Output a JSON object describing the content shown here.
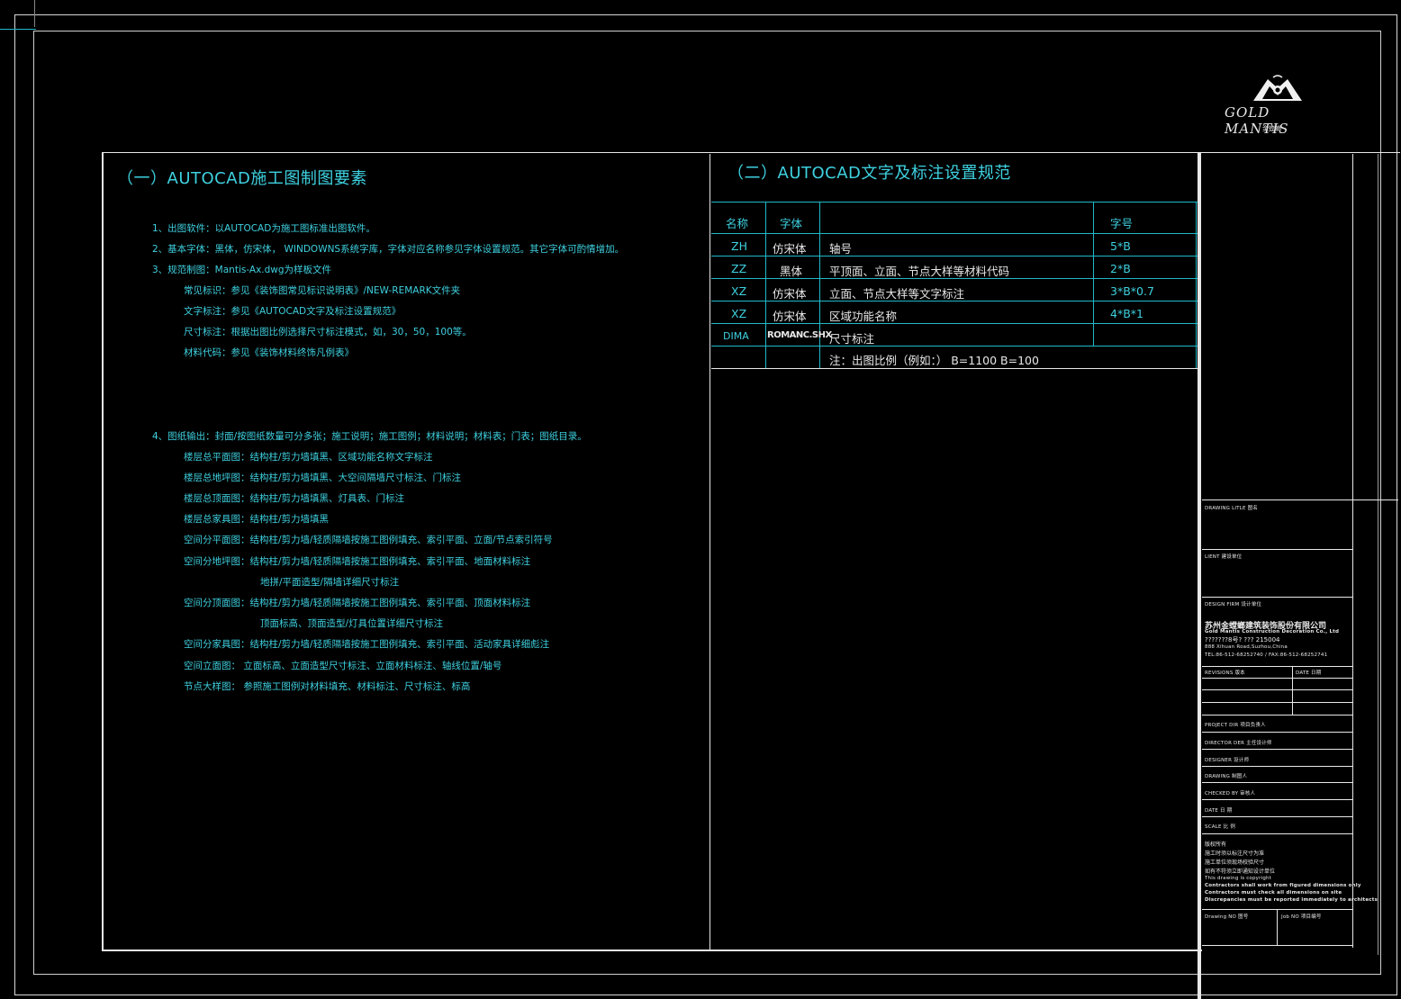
{
  "logo": {
    "brand_text": "GOLD MANTIS",
    "sub_text": "金螳螂",
    "icon": "mantis-logo-icon"
  },
  "section1": {
    "title": "（一）AUTOCAD施工图制图要素",
    "lines": [
      {
        "text": "1、出图软件：以AUTOCAD为施工图标准出图软件。",
        "indent": 0
      },
      {
        "text": "2、基本字体：黑体，仿宋体， WINDOWNS系统字库，字体对应名称参见字体设置规范。其它字体可酌情增加。",
        "indent": 0
      },
      {
        "text": "3、规范制图：Mantis-Ax.dwg为样板文件",
        "indent": 0
      },
      {
        "text": "常见标识：参见《装饰图常见标识说明表》/NEW-REMARK文件夹",
        "indent": 1
      },
      {
        "text": "文字标注：参见《AUTOCAD文字及标注设置规范》",
        "indent": 1
      },
      {
        "text": "尺寸标注：根据出图比例选择尺寸标注模式，如，30，50，100等。",
        "indent": 1
      },
      {
        "text": "材料代码：参见《装饰材料终饰凡例表》",
        "indent": 1
      }
    ],
    "lines2": [
      {
        "text": "4、图纸输出：封面/按图纸数量可分多张；施工说明；施工图例；材料说明；材料表；门表；图纸目录。",
        "indent": 0
      },
      {
        "text": "楼层总平面图：结构柱/剪力墙填黑、区域功能名称文字标注",
        "indent": 1
      },
      {
        "text": "楼层总地坪图：结构柱/剪力墙填黑、大空间隔墙尺寸标注、门标注",
        "indent": 1
      },
      {
        "text": "楼层总顶面图：结构柱/剪力墙填黑、灯具表、门标注",
        "indent": 1
      },
      {
        "text": "楼层总家具图：结构柱/剪力墙填黑",
        "indent": 1
      },
      {
        "text": "空间分平面图：结构柱/剪力墙/轻质隔墙按施工图例填充、索引平面、立面/节点索引符号",
        "indent": 1
      },
      {
        "text": "空间分地坪图：结构柱/剪力墙/轻质隔墙按施工图例填充、索引平面、地面材料标注",
        "indent": 1
      },
      {
        "text": "地拼/平面造型/隔墙详细尺寸标注",
        "indent": 2
      },
      {
        "text": "空间分顶面图：结构柱/剪力墙/轻质隔墙按施工图例填充、索引平面、顶面材料标注",
        "indent": 1
      },
      {
        "text": "顶面标高、顶面造型/灯具位置详细尺寸标注",
        "indent": 2
      },
      {
        "text": "空间分家具图：结构柱/剪力墙/轻质隔墙按施工图例填充、索引平面、活动家具详细彪注",
        "indent": 1
      },
      {
        "text": "空间立面图：   立面标高、立面造型尺寸标注、立面材料标注、轴线位置/轴号",
        "indent": 1
      },
      {
        "text": "节点大样图：   参照施工图例对材料填充、材料标注、尺寸标注、标高",
        "indent": 1
      }
    ]
  },
  "section2": {
    "title": "（二）AUTOCAD文字及标注设置规范",
    "headers": {
      "name": "名称",
      "font": "字体",
      "desc": "",
      "size": "字号"
    },
    "rows": [
      {
        "name": "ZH",
        "font": "仿宋体",
        "desc": "轴号",
        "size": "5*B"
      },
      {
        "name": "ZZ",
        "font": "黑体",
        "desc": "平顶面、立面、节点大样等材料代码",
        "size": "2*B"
      },
      {
        "name": "XZ",
        "font": "仿宋体",
        "desc": "立面、节点大样等文字标注",
        "size": "3*B*0.7"
      },
      {
        "name": "XZ",
        "font": "仿宋体",
        "desc": "区域功能名称",
        "size": "4*B*1"
      },
      {
        "name": "DIMA",
        "font": "ROMANC.SHX",
        "desc": "尺寸标注",
        "size": ""
      }
    ],
    "note": "注：出图比例（例如：）  B=1100    B=100"
  },
  "title_block": {
    "drawing_title": "DRAWING LITLE  图名",
    "client": "LIENT  建设单位",
    "design_firm": "DESIGN FIRM  设计单位",
    "firm_name_cn": "苏州金螳螂建筑装饰股份有限公司",
    "firm_name_en": "Gold Mantis Construction Decoration Co., Ltd",
    "firm_line3": "???????8号?   ???          215004",
    "firm_address": "888 Xihuan Road,Suzhou,China",
    "firm_tel": "TEL:86-512-68252740 / FAX:86-512-68252741",
    "revisions": "REVISIONS  版本",
    "date_col": "DATE  日期",
    "project_dir": "PROJECT DIR    项目负责人",
    "director": "DIRECTOR DER  主任设计师",
    "designer": "DESIGNER        设计师",
    "drawing": "DRAWING         制图人",
    "checked_by": "CHECKED BY     审核人",
    "date": "DATE              日  期",
    "scale": "SCALE             比  例",
    "copyright_lines": [
      "版权所有",
      "施工时须以标注尺寸为准",
      "施工单位须现场校验尺寸",
      "如有不符须立即通知设计单位",
      "This drawing is copyright",
      "Contractors shall work from figured dimensions only",
      "Contractors must check all dimensions on site",
      "Discrepancies must be reported immediately to architects"
    ],
    "drawing_no": "Drawing NO  图号",
    "job_no": "Job NO  项目编号"
  }
}
